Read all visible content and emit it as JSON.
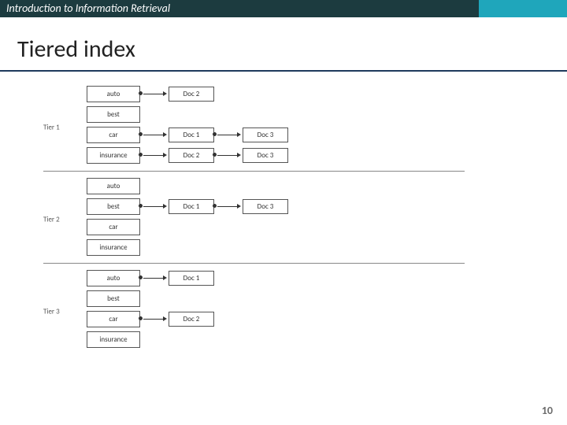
{
  "header": {
    "course": "Introduction to Information Retrieval"
  },
  "slide": {
    "title": "Tiered index",
    "number": "10"
  },
  "diagram": {
    "tiers": [
      {
        "label": "Tier 1",
        "rows": [
          {
            "term": "auto",
            "postings": [
              "Doc 2"
            ]
          },
          {
            "term": "best",
            "postings": []
          },
          {
            "term": "car",
            "postings": [
              "Doc 1",
              "Doc 3"
            ]
          },
          {
            "term": "insurance",
            "postings": [
              "Doc 2",
              "Doc 3"
            ]
          }
        ]
      },
      {
        "label": "Tier 2",
        "rows": [
          {
            "term": "auto",
            "postings": []
          },
          {
            "term": "best",
            "postings": [
              "Doc 1",
              "Doc 3"
            ]
          },
          {
            "term": "car",
            "postings": []
          },
          {
            "term": "insurance",
            "postings": []
          }
        ]
      },
      {
        "label": "Tier 3",
        "rows": [
          {
            "term": "auto",
            "postings": [
              "Doc 1"
            ]
          },
          {
            "term": "best",
            "postings": []
          },
          {
            "term": "car",
            "postings": [
              "Doc 2"
            ]
          },
          {
            "term": "insurance",
            "postings": []
          }
        ]
      }
    ]
  }
}
